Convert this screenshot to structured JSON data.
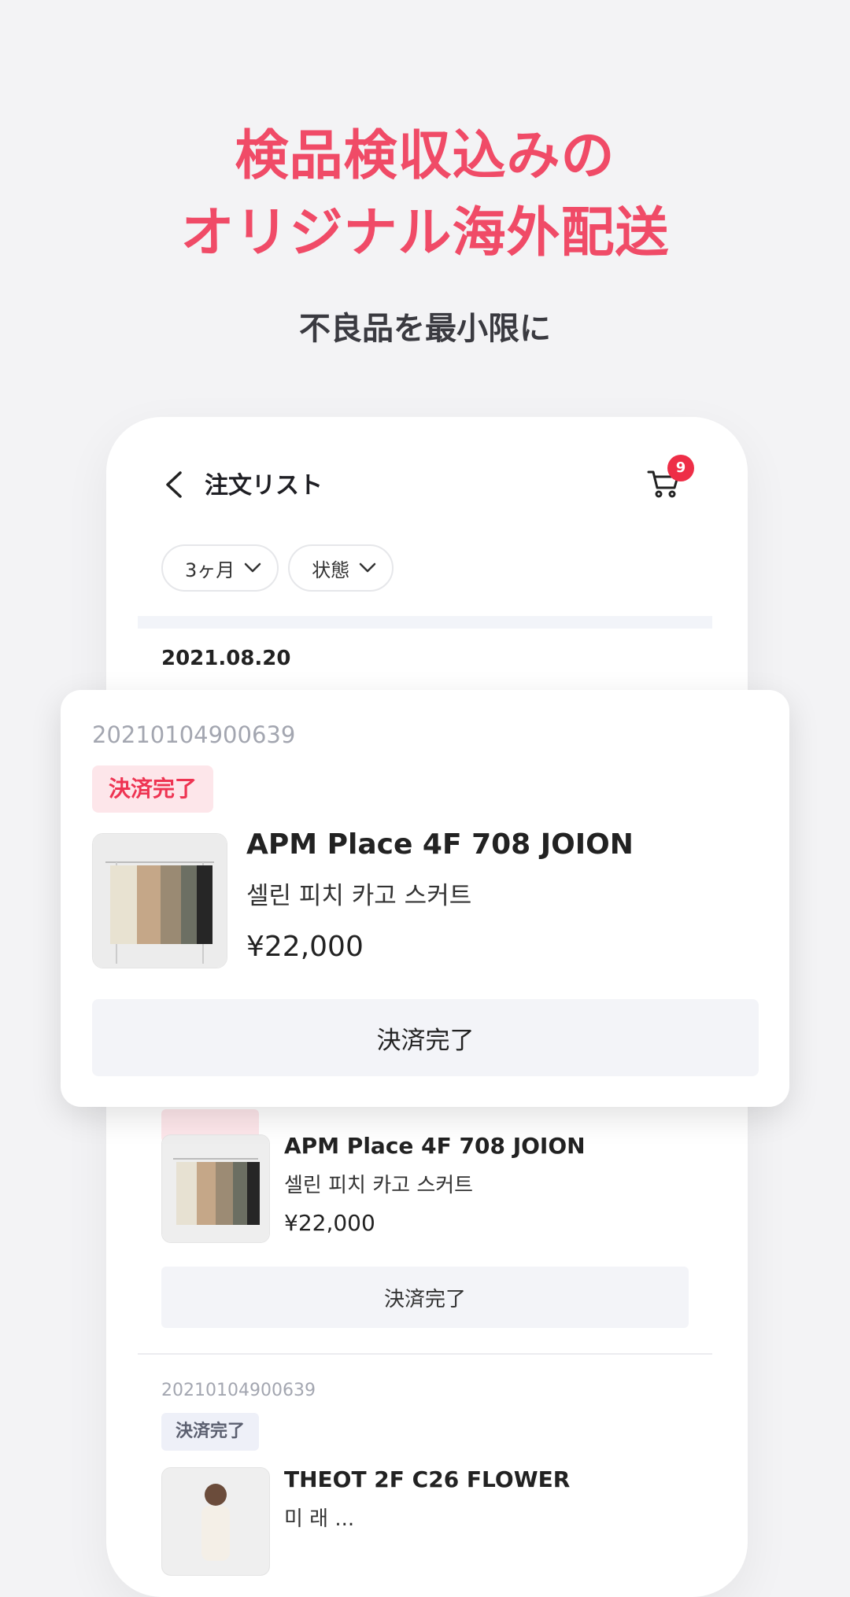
{
  "promo": {
    "headline_line1": "検品検収込みの",
    "headline_line2": "オリジナル海外配送",
    "subheadline": "不良品を最小限に",
    "accent_color": "#f04b67"
  },
  "app_header": {
    "title": "注文リスト",
    "back_icon": "chevron-left-icon",
    "cart_icon": "cart-icon",
    "cart_count": "9"
  },
  "filters": [
    {
      "label": "3ヶ月",
      "icon": "chevron-down-icon"
    },
    {
      "label": "状態",
      "icon": "chevron-down-icon"
    }
  ],
  "order_date": "2021.08.20",
  "featured_order": {
    "order_no": "20210104900639",
    "status": "決済完了",
    "store": "APM Place 4F 708 JOION",
    "item": "셀린 피치 카고 스커트",
    "price": "¥22,000",
    "button": "決済完了"
  },
  "orders": [
    {
      "store": "APM Place 4F 708 JOION",
      "item": "셀린 피치 카고 스커트",
      "price": "¥22,000",
      "button": "決済完了"
    },
    {
      "order_no": "20210104900639",
      "status": "決済完了",
      "store": "THEOT 2F C26 FLOWER",
      "item": "미 래 ..."
    }
  ]
}
